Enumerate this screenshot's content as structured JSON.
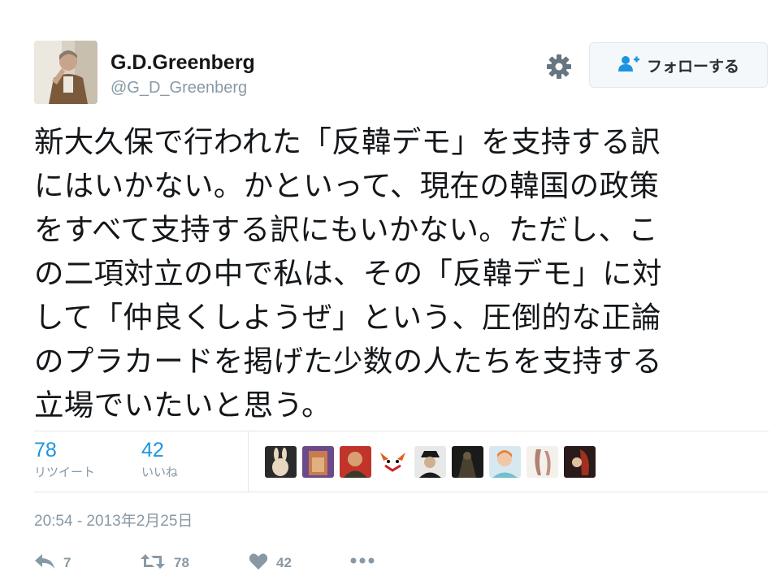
{
  "user": {
    "display_name": "G.D.Greenberg",
    "handle": "@G_D_Greenberg",
    "follow_label": "フォローする"
  },
  "tweet": {
    "lines": [
      "新大久保で行われた「反韓デモ」を支持する訳",
      "にはいかない。かといって、現在の韓国の政策",
      "をすべて支持する訳にもいかない。ただし、こ",
      "の二項対立の中で私は、その「反韓デモ」に対",
      "して「仲良くしようぜ」という、圧倒的な正論",
      "のプラカードを掲げた少数の人たちを支持する",
      "立場でいたいと思う。"
    ]
  },
  "stats": {
    "retweets_count": "78",
    "retweets_label": "リツイート",
    "likes_count": "42",
    "likes_label": "いいね"
  },
  "timestamp": "20:54 - 2013年2月25日",
  "actions": {
    "reply_count": "7",
    "retweet_count": "78",
    "like_count": "42"
  },
  "colors": {
    "accent": "#1b95e0",
    "muted": "#8899a6",
    "text": "#14171a",
    "border": "#e1e8ed"
  }
}
